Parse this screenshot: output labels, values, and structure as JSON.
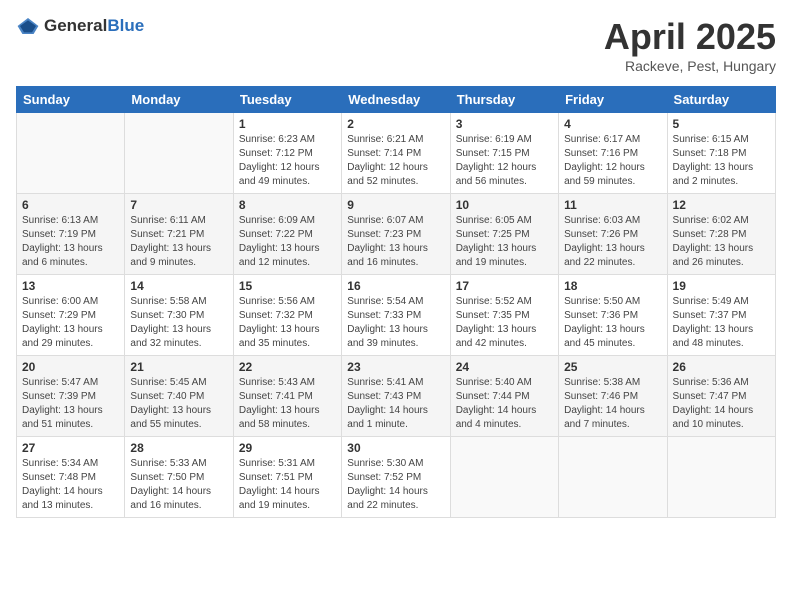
{
  "logo": {
    "general": "General",
    "blue": "Blue"
  },
  "title": {
    "month": "April 2025",
    "location": "Rackeve, Pest, Hungary"
  },
  "headers": [
    "Sunday",
    "Monday",
    "Tuesday",
    "Wednesday",
    "Thursday",
    "Friday",
    "Saturday"
  ],
  "weeks": [
    {
      "shaded": false,
      "days": [
        {
          "num": "",
          "sunrise": "",
          "sunset": "",
          "daylight": ""
        },
        {
          "num": "",
          "sunrise": "",
          "sunset": "",
          "daylight": ""
        },
        {
          "num": "1",
          "sunrise": "Sunrise: 6:23 AM",
          "sunset": "Sunset: 7:12 PM",
          "daylight": "Daylight: 12 hours and 49 minutes."
        },
        {
          "num": "2",
          "sunrise": "Sunrise: 6:21 AM",
          "sunset": "Sunset: 7:14 PM",
          "daylight": "Daylight: 12 hours and 52 minutes."
        },
        {
          "num": "3",
          "sunrise": "Sunrise: 6:19 AM",
          "sunset": "Sunset: 7:15 PM",
          "daylight": "Daylight: 12 hours and 56 minutes."
        },
        {
          "num": "4",
          "sunrise": "Sunrise: 6:17 AM",
          "sunset": "Sunset: 7:16 PM",
          "daylight": "Daylight: 12 hours and 59 minutes."
        },
        {
          "num": "5",
          "sunrise": "Sunrise: 6:15 AM",
          "sunset": "Sunset: 7:18 PM",
          "daylight": "Daylight: 13 hours and 2 minutes."
        }
      ]
    },
    {
      "shaded": true,
      "days": [
        {
          "num": "6",
          "sunrise": "Sunrise: 6:13 AM",
          "sunset": "Sunset: 7:19 PM",
          "daylight": "Daylight: 13 hours and 6 minutes."
        },
        {
          "num": "7",
          "sunrise": "Sunrise: 6:11 AM",
          "sunset": "Sunset: 7:21 PM",
          "daylight": "Daylight: 13 hours and 9 minutes."
        },
        {
          "num": "8",
          "sunrise": "Sunrise: 6:09 AM",
          "sunset": "Sunset: 7:22 PM",
          "daylight": "Daylight: 13 hours and 12 minutes."
        },
        {
          "num": "9",
          "sunrise": "Sunrise: 6:07 AM",
          "sunset": "Sunset: 7:23 PM",
          "daylight": "Daylight: 13 hours and 16 minutes."
        },
        {
          "num": "10",
          "sunrise": "Sunrise: 6:05 AM",
          "sunset": "Sunset: 7:25 PM",
          "daylight": "Daylight: 13 hours and 19 minutes."
        },
        {
          "num": "11",
          "sunrise": "Sunrise: 6:03 AM",
          "sunset": "Sunset: 7:26 PM",
          "daylight": "Daylight: 13 hours and 22 minutes."
        },
        {
          "num": "12",
          "sunrise": "Sunrise: 6:02 AM",
          "sunset": "Sunset: 7:28 PM",
          "daylight": "Daylight: 13 hours and 26 minutes."
        }
      ]
    },
    {
      "shaded": false,
      "days": [
        {
          "num": "13",
          "sunrise": "Sunrise: 6:00 AM",
          "sunset": "Sunset: 7:29 PM",
          "daylight": "Daylight: 13 hours and 29 minutes."
        },
        {
          "num": "14",
          "sunrise": "Sunrise: 5:58 AM",
          "sunset": "Sunset: 7:30 PM",
          "daylight": "Daylight: 13 hours and 32 minutes."
        },
        {
          "num": "15",
          "sunrise": "Sunrise: 5:56 AM",
          "sunset": "Sunset: 7:32 PM",
          "daylight": "Daylight: 13 hours and 35 minutes."
        },
        {
          "num": "16",
          "sunrise": "Sunrise: 5:54 AM",
          "sunset": "Sunset: 7:33 PM",
          "daylight": "Daylight: 13 hours and 39 minutes."
        },
        {
          "num": "17",
          "sunrise": "Sunrise: 5:52 AM",
          "sunset": "Sunset: 7:35 PM",
          "daylight": "Daylight: 13 hours and 42 minutes."
        },
        {
          "num": "18",
          "sunrise": "Sunrise: 5:50 AM",
          "sunset": "Sunset: 7:36 PM",
          "daylight": "Daylight: 13 hours and 45 minutes."
        },
        {
          "num": "19",
          "sunrise": "Sunrise: 5:49 AM",
          "sunset": "Sunset: 7:37 PM",
          "daylight": "Daylight: 13 hours and 48 minutes."
        }
      ]
    },
    {
      "shaded": true,
      "days": [
        {
          "num": "20",
          "sunrise": "Sunrise: 5:47 AM",
          "sunset": "Sunset: 7:39 PM",
          "daylight": "Daylight: 13 hours and 51 minutes."
        },
        {
          "num": "21",
          "sunrise": "Sunrise: 5:45 AM",
          "sunset": "Sunset: 7:40 PM",
          "daylight": "Daylight: 13 hours and 55 minutes."
        },
        {
          "num": "22",
          "sunrise": "Sunrise: 5:43 AM",
          "sunset": "Sunset: 7:41 PM",
          "daylight": "Daylight: 13 hours and 58 minutes."
        },
        {
          "num": "23",
          "sunrise": "Sunrise: 5:41 AM",
          "sunset": "Sunset: 7:43 PM",
          "daylight": "Daylight: 14 hours and 1 minute."
        },
        {
          "num": "24",
          "sunrise": "Sunrise: 5:40 AM",
          "sunset": "Sunset: 7:44 PM",
          "daylight": "Daylight: 14 hours and 4 minutes."
        },
        {
          "num": "25",
          "sunrise": "Sunrise: 5:38 AM",
          "sunset": "Sunset: 7:46 PM",
          "daylight": "Daylight: 14 hours and 7 minutes."
        },
        {
          "num": "26",
          "sunrise": "Sunrise: 5:36 AM",
          "sunset": "Sunset: 7:47 PM",
          "daylight": "Daylight: 14 hours and 10 minutes."
        }
      ]
    },
    {
      "shaded": false,
      "days": [
        {
          "num": "27",
          "sunrise": "Sunrise: 5:34 AM",
          "sunset": "Sunset: 7:48 PM",
          "daylight": "Daylight: 14 hours and 13 minutes."
        },
        {
          "num": "28",
          "sunrise": "Sunrise: 5:33 AM",
          "sunset": "Sunset: 7:50 PM",
          "daylight": "Daylight: 14 hours and 16 minutes."
        },
        {
          "num": "29",
          "sunrise": "Sunrise: 5:31 AM",
          "sunset": "Sunset: 7:51 PM",
          "daylight": "Daylight: 14 hours and 19 minutes."
        },
        {
          "num": "30",
          "sunrise": "Sunrise: 5:30 AM",
          "sunset": "Sunset: 7:52 PM",
          "daylight": "Daylight: 14 hours and 22 minutes."
        },
        {
          "num": "",
          "sunrise": "",
          "sunset": "",
          "daylight": ""
        },
        {
          "num": "",
          "sunrise": "",
          "sunset": "",
          "daylight": ""
        },
        {
          "num": "",
          "sunrise": "",
          "sunset": "",
          "daylight": ""
        }
      ]
    }
  ]
}
